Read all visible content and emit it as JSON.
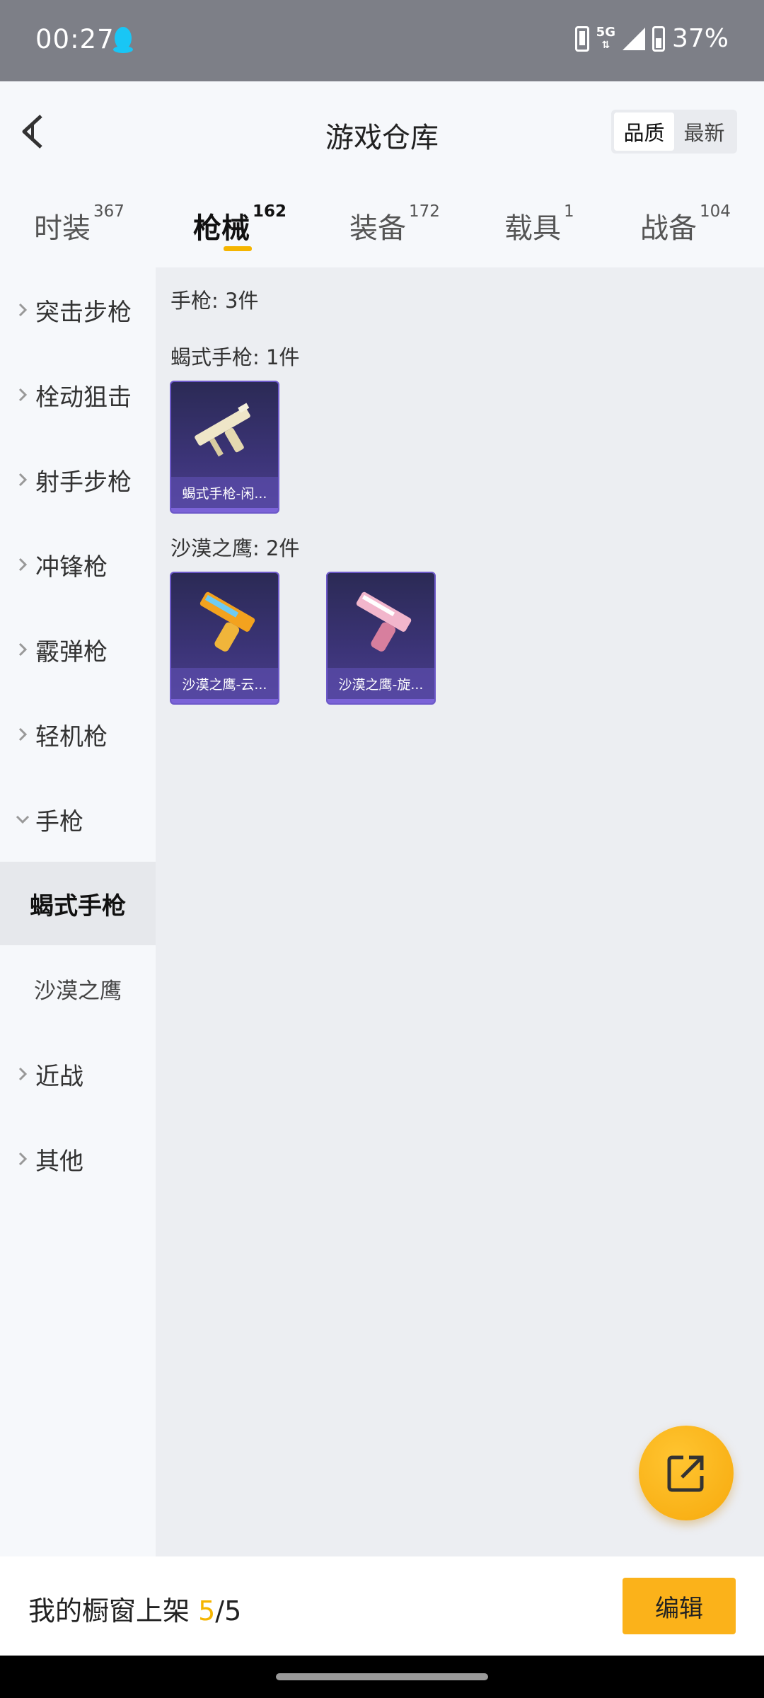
{
  "status_bar": {
    "time": "00:27",
    "network": "5G",
    "battery": "37%",
    "icons": [
      "qq-icon",
      "sim-icon",
      "network-5g-icon",
      "signal-icon",
      "battery-charging-icon"
    ]
  },
  "header": {
    "title": "游戏仓库",
    "sort_options": [
      "品质",
      "最新"
    ],
    "active_sort": "品质"
  },
  "tabs": [
    {
      "label": "时装",
      "count": "367"
    },
    {
      "label": "枪械",
      "count": "162"
    },
    {
      "label": "装备",
      "count": "172"
    },
    {
      "label": "载具",
      "count": "1"
    },
    {
      "label": "战备",
      "count": "104"
    }
  ],
  "active_tab": "枪械",
  "active_tab_color": "#f5b500",
  "sidebar": {
    "items": [
      {
        "label": "突击步枪"
      },
      {
        "label": "栓动狙击"
      },
      {
        "label": "射手步枪"
      },
      {
        "label": "冲锋枪"
      },
      {
        "label": "霰弹枪"
      },
      {
        "label": "轻机枪"
      },
      {
        "label": "手枪"
      },
      {
        "label": "近战"
      },
      {
        "label": "其他"
      }
    ],
    "expanded": "手枪",
    "sub_items": [
      {
        "label": "蝎式手枪"
      },
      {
        "label": "沙漠之鹰"
      }
    ],
    "selected_sub": "蝎式手枪"
  },
  "content": {
    "summary": "手枪: 3件",
    "groups": [
      {
        "title": "蝎式手枪: 1件",
        "items": [
          {
            "label": "蝎式手枪-闲..."
          }
        ]
      },
      {
        "title": "沙漠之鹰: 2件",
        "items": [
          {
            "label": "沙漠之鹰-云..."
          },
          {
            "label": "沙漠之鹰-旋..."
          }
        ]
      }
    ]
  },
  "fab": {
    "icon": "share-external-icon",
    "color": "#f7a90c"
  },
  "bottom_bar": {
    "label": "我的橱窗上架",
    "current": "5",
    "total": "/5",
    "edit_label": "编辑",
    "button_color": "#fbb21a"
  }
}
